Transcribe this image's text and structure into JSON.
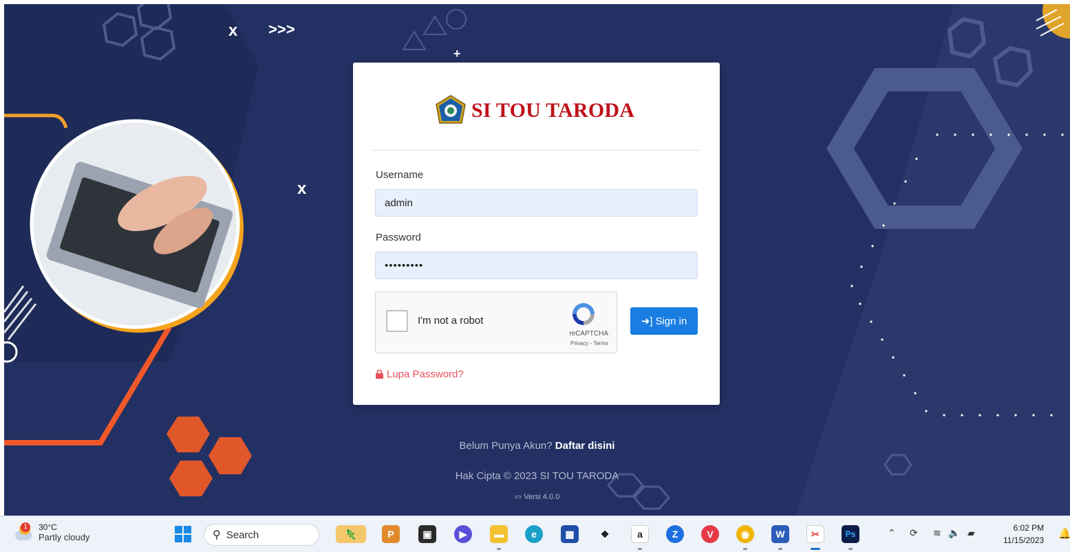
{
  "logo": {
    "text": "SI TOU TARODA"
  },
  "form": {
    "username_label": "Username",
    "username_value": "admin",
    "password_label": "Password",
    "password_value": "•••••••••",
    "captcha_label": "I'm not a robot",
    "captcha_brand": "reCAPTCHA",
    "captcha_links": "Privacy - Terms",
    "signin_label": "Sign in",
    "forgot_label": "Lupa Password?"
  },
  "footer": {
    "register_prompt": "Belum Punya Akun?",
    "register_link": "Daftar disini",
    "copyright": "Hak Cipta © 2023 SI TOU TARODA",
    "version": "Versi 4.0.0"
  },
  "taskbar": {
    "weather_badge": "1",
    "weather_temp": "30°C",
    "weather_cond": "Partly cloudy",
    "search_label": "Search",
    "time": "6:02 PM",
    "date": "11/15/2023"
  },
  "colors": {
    "background": "#233063",
    "brand_red": "#c0111a",
    "signin_blue": "#1a7de2",
    "forgot_red": "#e8505b",
    "accent_orange": "#f0582a"
  }
}
